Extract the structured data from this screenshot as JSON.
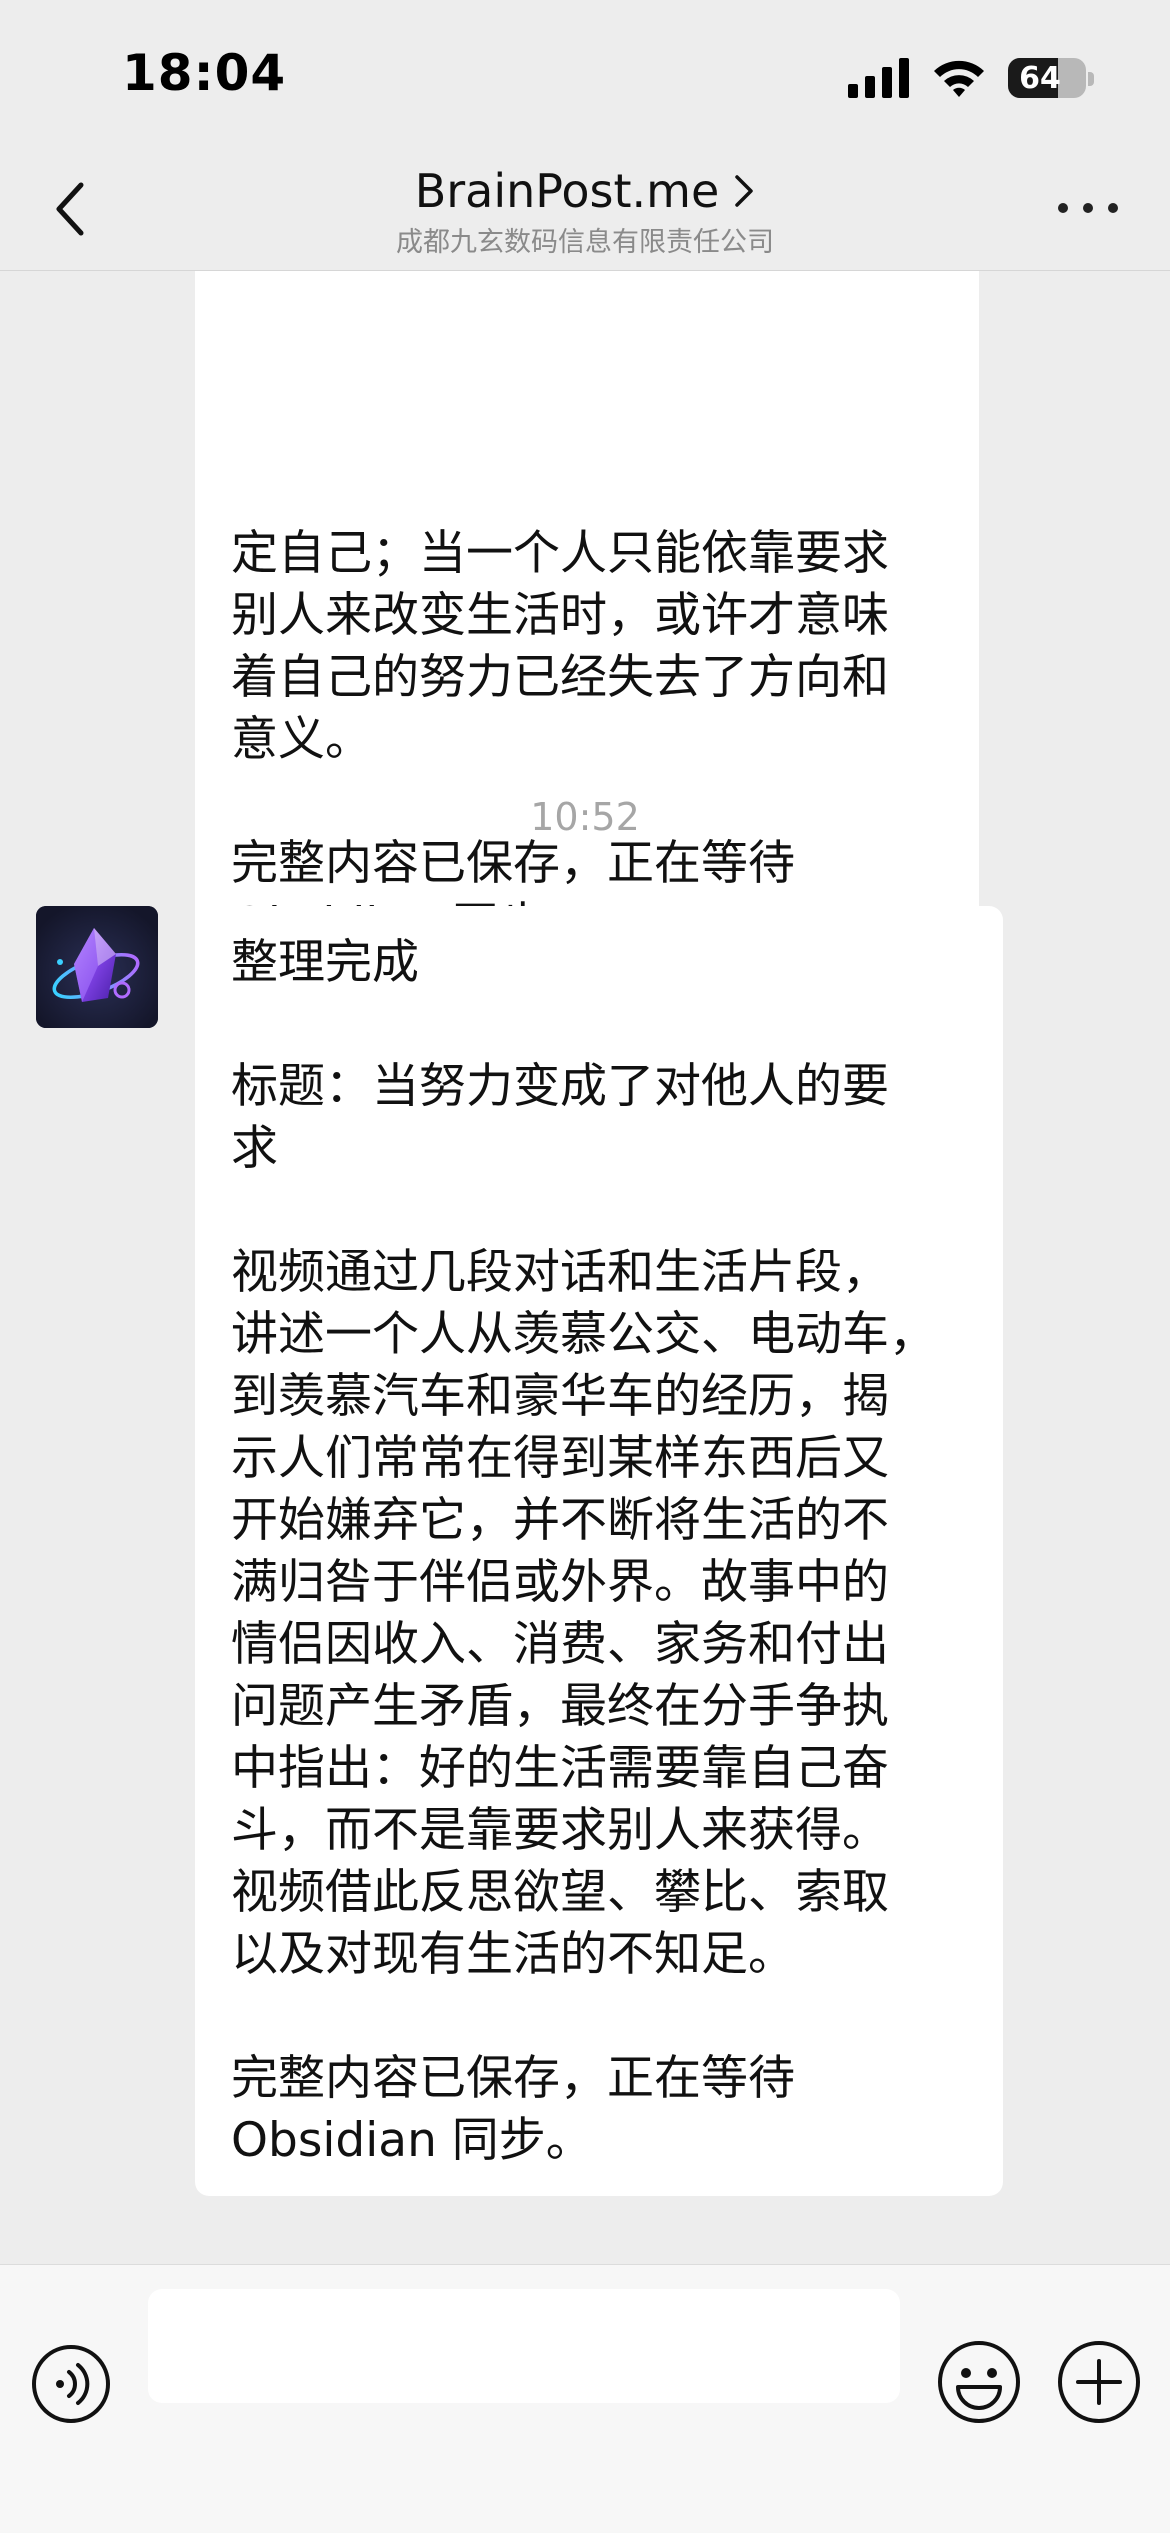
{
  "status_bar": {
    "time": "18:04",
    "battery_level": "64",
    "battery_fraction": 0.64,
    "icons": [
      "signal-icon",
      "wifi-icon",
      "battery-icon"
    ]
  },
  "header": {
    "title": "BrainPost.me",
    "subtitle": "成都九玄数码信息有限责任公司",
    "icons": [
      "back-icon",
      "chevron-right-icon",
      "more-icon"
    ]
  },
  "chat": {
    "previous_message": {
      "lines": [
        "定自己；当一个人只能依靠要求",
        "别人来改变生活时，或许才意味",
        "着自己的努力已经失去了方向和",
        "意义。",
        "",
        "完整内容已保存，正在等待",
        "Obsidian 同步。"
      ]
    },
    "timestamp": "10:52",
    "message": {
      "sender_avatar_icon": "obsidian-crystal-icon",
      "paragraphs": [
        [
          "整理完成"
        ],
        [
          "标题：当努力变成了对他人的要",
          "求"
        ],
        [
          "视频通过几段对话和生活片段，",
          "讲述一个人从羡慕公交、电动车，",
          "到羡慕汽车和豪华车的经历，揭",
          "示人们常常在得到某样东西后又",
          "开始嫌弃它，并不断将生活的不",
          "满归咎于伴侣或外界。故事中的",
          "情侣因收入、消费、家务和付出",
          "问题产生矛盾，最终在分手争执",
          "中指出：好的生活需要靠自己奋",
          "斗，而不是靠要求别人来获得。",
          "视频借此反思欲望、攀比、索取",
          "以及对现有生活的不知足。"
        ],
        [
          "完整内容已保存，正在等待",
          "Obsidian 同步。"
        ]
      ]
    }
  },
  "input_bar": {
    "value": "",
    "placeholder": "",
    "icons": [
      "voice-icon",
      "emoji-icon",
      "add-icon"
    ]
  }
}
